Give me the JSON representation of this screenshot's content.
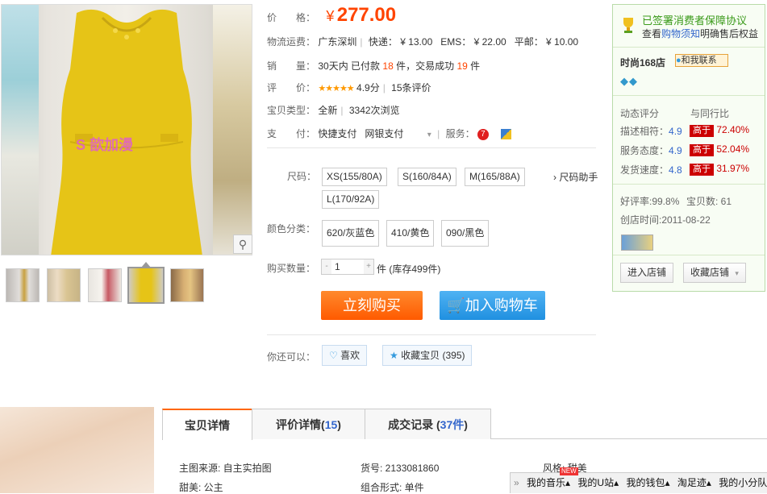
{
  "gallery": {
    "watermark": "S 歆加漫",
    "thumbnails": [
      "thumb-1",
      "thumb-2",
      "thumb-3",
      "thumb-4",
      "thumb-5"
    ],
    "zoom_icon": "magnifier-icon"
  },
  "price": {
    "label": "价　　格：",
    "currency": "¥",
    "value": "277.00"
  },
  "shipping": {
    "label": "物流运费：",
    "location": "广东深圳",
    "express_label": "快递：",
    "express": "¥ 13.00",
    "ems_label": "EMS：",
    "ems": "¥ 22.00",
    "post_label": "平邮：",
    "post": "¥ 10.00"
  },
  "sales": {
    "label": "销　　量：",
    "prefix": "30天内 已付款",
    "paid": "18",
    "mid": "件，交易成功",
    "success": "19",
    "suffix": "件"
  },
  "review": {
    "label": "评　　价：",
    "stars": "★★★★★",
    "score": "4.9分",
    "count": "15条评价"
  },
  "type": {
    "label": "宝贝类型：",
    "value": "全新",
    "views": "3342次浏览"
  },
  "payment": {
    "label": "支　　付：",
    "m1": "快捷支付",
    "m2": "网银支付",
    "more": "▾",
    "service_label": "服务："
  },
  "size": {
    "label": "尺码：",
    "options": [
      "XS(155/80A)",
      "S(160/84A)",
      "M(165/88A)",
      "L(170/92A)"
    ],
    "helper": "尺码助手"
  },
  "colors": {
    "label": "颜色分类：",
    "options": [
      "620/灰蓝色",
      "410/黄色",
      "090/黑色"
    ]
  },
  "quantity": {
    "label": "购买数量：",
    "value": "1",
    "minus": "-",
    "plus": "+",
    "unit": "件",
    "stock": "(库存499件)"
  },
  "actions": {
    "buy": "立刻购买",
    "cart": "加入购物车"
  },
  "social": {
    "label": "你还可以：",
    "like": "喜欢",
    "favorite": "收藏宝贝",
    "fav_count": "(395)"
  },
  "shop": {
    "guarantee_title": "已签署消费者保障协议",
    "guarantee_sub_a": "查看",
    "guarantee_link": "购物须知",
    "guarantee_sub_b": "明确售后权益",
    "name": "时尚168店",
    "contact": "和我联系",
    "dyn_label": "动态评分",
    "peer_label": "与同行比",
    "ratings": [
      {
        "label": "描述相符：",
        "score": "4.9",
        "tag": "高于",
        "pct": "72.40%"
      },
      {
        "label": "服务态度：",
        "score": "4.9",
        "tag": "高于",
        "pct": "52.04%"
      },
      {
        "label": "发货速度：",
        "score": "4.8",
        "tag": "高于",
        "pct": "31.97%"
      }
    ],
    "good_rate": "好评率:99.8%",
    "item_count": "宝贝数: 61",
    "created": "创店时间:2011-08-22",
    "enter": "进入店铺",
    "collect": "收藏店铺"
  },
  "tabs": [
    {
      "label": "宝贝详情",
      "count": ""
    },
    {
      "label": "评价详情(",
      "count": "15",
      "close": ")"
    },
    {
      "label": "成交记录 (",
      "count": "37件",
      "close": ")"
    }
  ],
  "attributes": {
    "source": "主图来源: 自主实拍图",
    "item_no": "货号: 2133081860",
    "style": "风格: 甜美",
    "sweet": "甜美: 公主",
    "combo": "组合形式: 单件"
  },
  "music_bar": {
    "items": [
      "我的音乐▴",
      "我的U站▴",
      "我的钱包▴",
      "淘足迹▴",
      "我的小分队"
    ],
    "new_badge": "NEW"
  },
  "colors_theme": {
    "accent": "#ff4400",
    "buy": "#ff6600",
    "cart": "#2a9be8",
    "link": "#3366cc"
  }
}
